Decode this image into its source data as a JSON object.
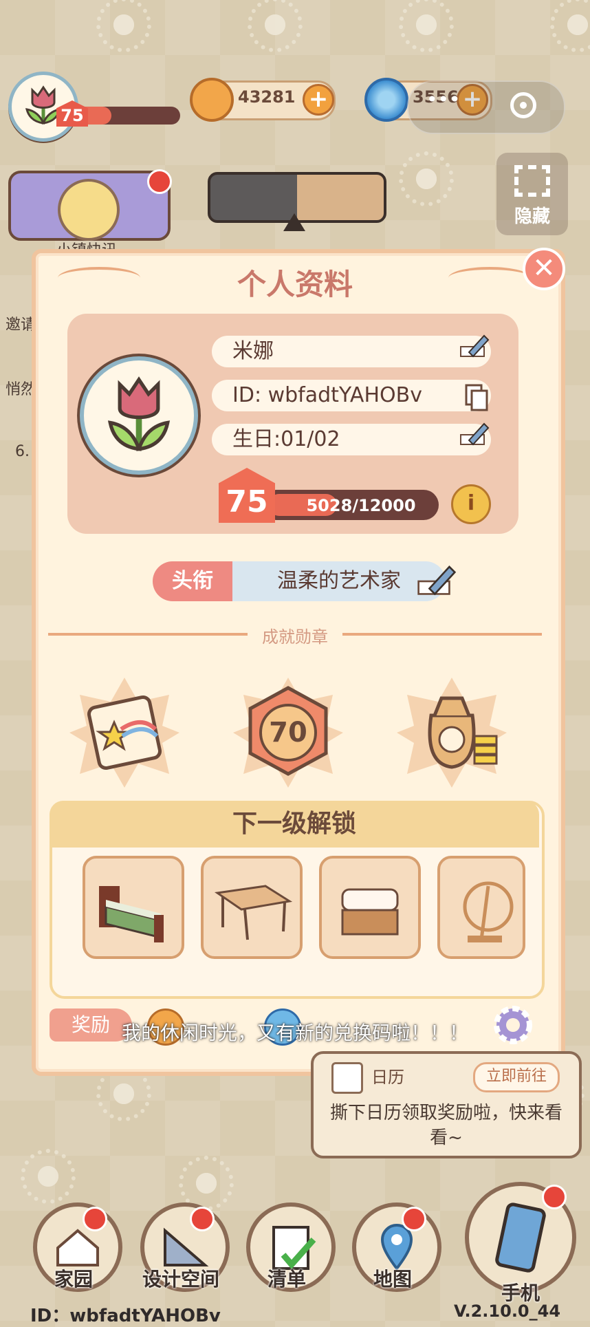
{
  "top_bar": {
    "player_level": "75",
    "coins": "43281",
    "gems": "3556",
    "plus_symbol": "+",
    "capsule_more": "•••"
  },
  "side": {
    "hide_label": "隐藏",
    "event_label": "小镇快讯",
    "invite_label": "邀请",
    "quiet_label": "悄然",
    "side_number": "6."
  },
  "panel": {
    "title": "个人资料",
    "close_symbol": "✕",
    "name": "米娜",
    "id_text": "ID: wbfadtYAHOBv",
    "birthday": "生日:01/02",
    "level": "75",
    "xp_text": "5028/12000",
    "xp_fraction": 0.419,
    "info_symbol": "i",
    "title_label": "头衔",
    "title_value": "温柔的艺术家",
    "achievements_label": "成就勋章",
    "achievement_medals": [
      "star-scroll-medal",
      "level-70-medal",
      "money-bag-medal"
    ],
    "medal_70_text": "70",
    "unlock_header": "下一级解锁",
    "unlock_items": [
      "bed",
      "wooden-table",
      "cushion-stool",
      "decorative-stand"
    ],
    "reward_label": "奖励"
  },
  "subtitle": "我的休闲时光，又有新的兑换码啦！！！",
  "tooltip": {
    "title": "日历",
    "go_button": "立即前往",
    "description": "撕下日历领取奖励啦，快来看看~"
  },
  "bottom_nav": [
    {
      "label": "家园"
    },
    {
      "label": "设计空间"
    },
    {
      "label": "清单"
    },
    {
      "label": "地图"
    },
    {
      "label": "手机"
    }
  ],
  "footer": {
    "id": "ID：wbfadtYAHOBv",
    "version": "V.2.10.0_44"
  }
}
